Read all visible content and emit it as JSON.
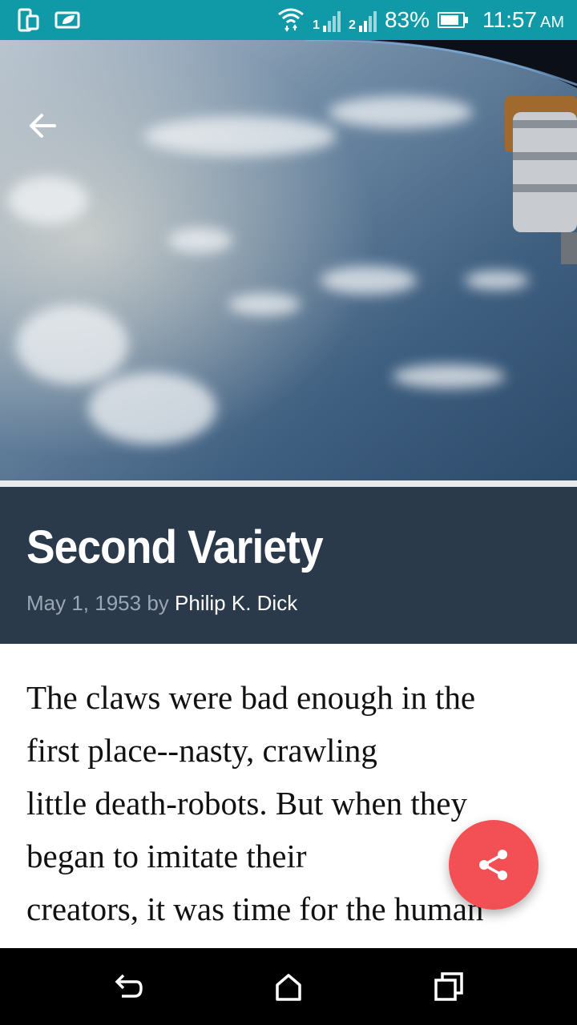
{
  "status_bar": {
    "battery_text": "83%",
    "battery_level": 0.83,
    "time": "11:57",
    "ampm": "AM",
    "sim1": "1",
    "sim2": "2",
    "icons": [
      "phone-tablet-icon",
      "leaf-icon",
      "wifi-icon",
      "signal-sim1-icon",
      "signal-sim2-icon",
      "battery-icon"
    ]
  },
  "hero": {
    "back_icon": "arrow-left-icon"
  },
  "article": {
    "title": "Second Variety",
    "date": "May 1, 1953",
    "by": "by",
    "author": "Philip K. Dick",
    "body_lines": [
      "The claws were bad enough in the",
      "first place--nasty, crawling",
      "little death-robots. But when they",
      "began to imitate their",
      "creators, it was time for the human"
    ]
  },
  "fab": {
    "icon": "share-icon",
    "color": "#f25054"
  },
  "nav_bar": {
    "icons": [
      "back-icon",
      "home-icon",
      "recents-icon"
    ]
  },
  "colors": {
    "status_bar": "#109aa8",
    "title_band": "#2b3a4a"
  }
}
